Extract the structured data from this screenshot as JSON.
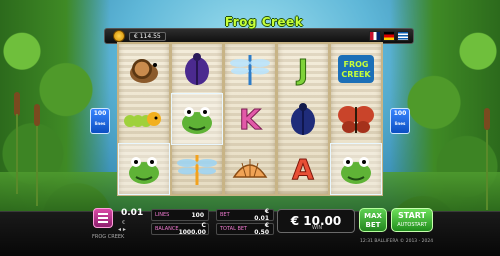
{
  "game": {
    "title": "Frog Creek",
    "name_footer": "FROG CREEK"
  },
  "topbar": {
    "balance": "€ 114.55",
    "flags": [
      "flag-uk",
      "flag-de",
      "flag-gr"
    ]
  },
  "reels": [
    {
      "symbols": [
        "snail",
        "caterpillar",
        "frog"
      ]
    },
    {
      "symbols": [
        "beetle",
        "frog",
        "dragonfly"
      ]
    },
    {
      "symbols": [
        "dragonfly",
        "K",
        "shell"
      ]
    },
    {
      "symbols": [
        "J",
        "beetle",
        "A"
      ]
    },
    {
      "symbols": [
        "frog-creek-logo",
        "butterfly",
        "frog"
      ]
    }
  ],
  "reels_extra_rows": [
    [
      "frog",
      "J"
    ],
    [
      "frog",
      "caterpillar"
    ]
  ],
  "side_badges": {
    "left": "100",
    "right": "100",
    "unit": "lines"
  },
  "bottom": {
    "coin_value": "0.01",
    "coin_value_label": "€",
    "lines_label": "LINES",
    "lines_value": "100",
    "bet_label": "BET",
    "bet_value": "€ 0.01",
    "balance_label": "BALANCE",
    "balance_value": "C 1000.00",
    "total_bet_label": "TOTAL BET",
    "total_bet_value": "€ 0.50",
    "win_value": "€ 10.00",
    "win_label": "WIN",
    "max_bet_label": "MAX BET",
    "start_label": "START",
    "autostart_label": "AUTOSTART",
    "info": "12:31  BALLIFERA © 2013 - 2024"
  }
}
